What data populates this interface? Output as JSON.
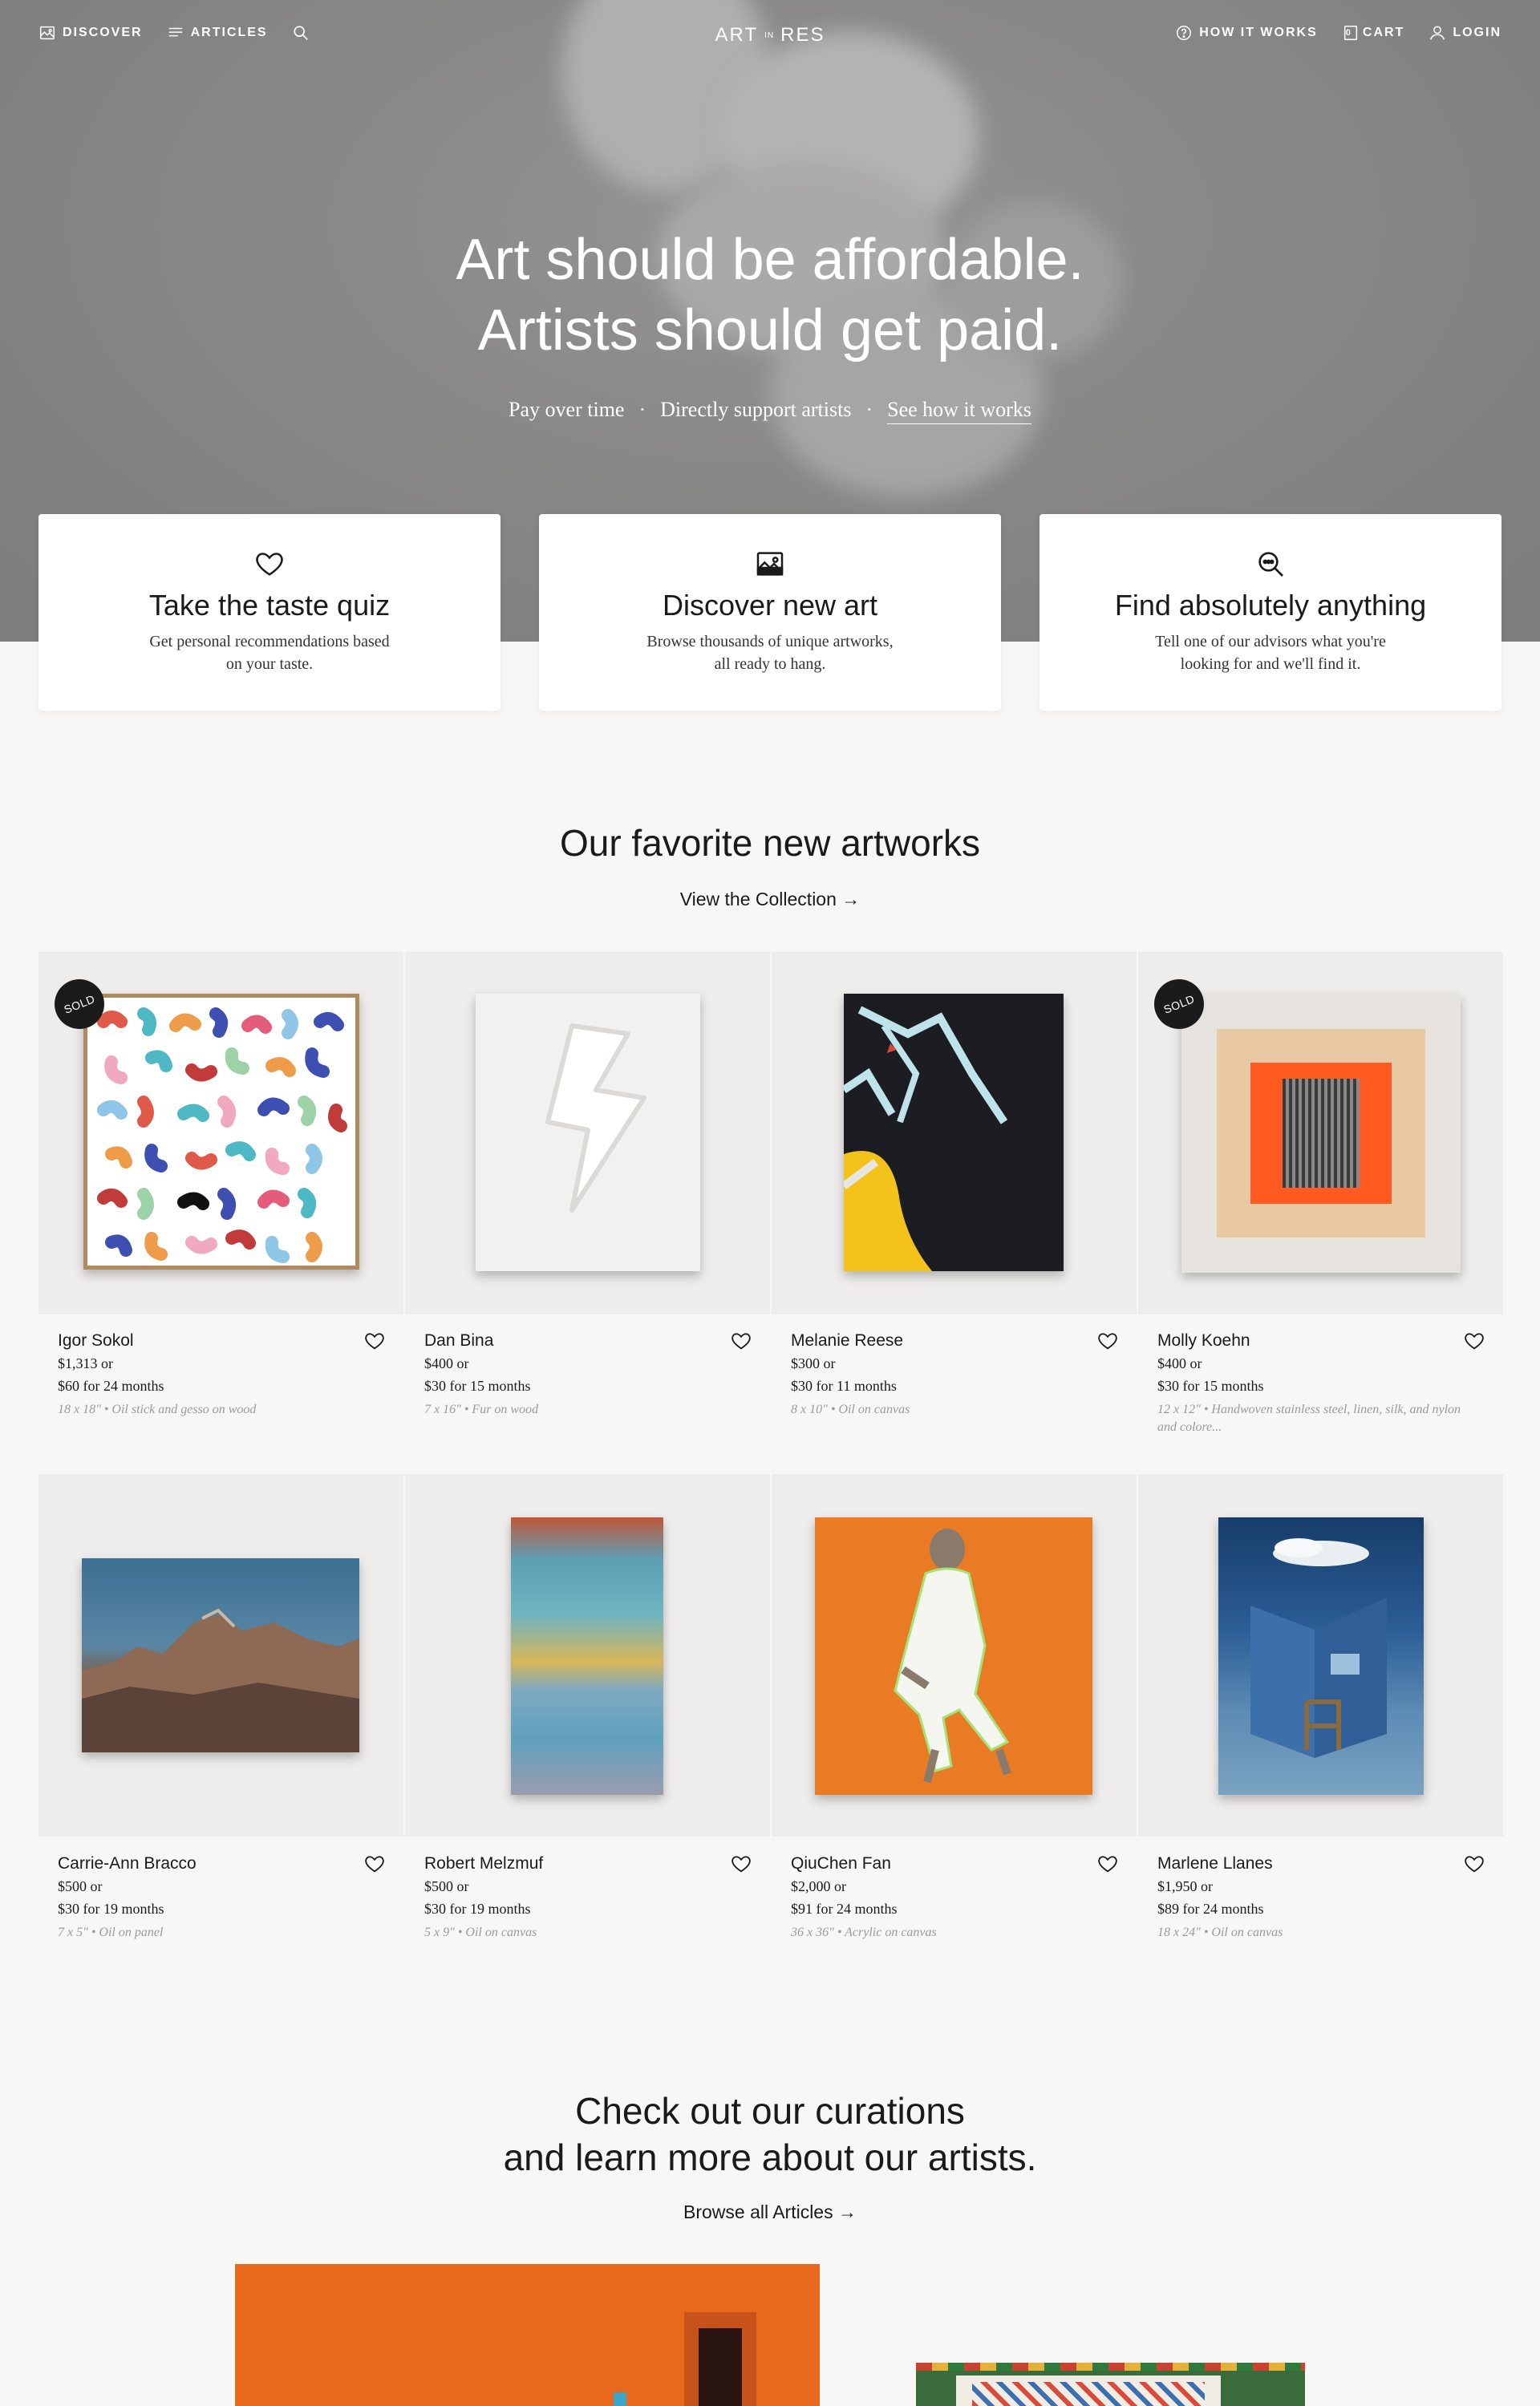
{
  "nav": {
    "discover": "DISCOVER",
    "articles": "ARTICLES",
    "logo_left": "ART",
    "logo_mid": "IN",
    "logo_right": "RES",
    "how_it_works": "HOW IT WORKS",
    "cart_count": "0",
    "cart": "CART",
    "login": "LOGIN"
  },
  "hero": {
    "title_line1": "Art should be affordable.",
    "title_line2": "Artists should get paid.",
    "sub1": "Pay over time",
    "sub2": "Directly support artists",
    "sub3": "See how it works",
    "dot": "·"
  },
  "features": [
    {
      "title": "Take the taste quiz",
      "desc": "Get personal recommendations based on your taste.",
      "icon": "heart-icon"
    },
    {
      "title": "Discover new art",
      "desc": "Browse thousands of unique artworks, all ready to hang.",
      "icon": "image-icon"
    },
    {
      "title": "Find absolutely anything",
      "desc": "Tell one of our advisors what you're looking for and we'll find it.",
      "icon": "search-chat-icon"
    }
  ],
  "favorites": {
    "title": "Our favorite new artworks",
    "link": "View the Collection →"
  },
  "artworks": [
    {
      "artist": "Igor Sokol",
      "price": "$1,313 or",
      "monthly": "$60 for 24 months",
      "details": "18 x 18\" • Oil stick and gesso on wood",
      "sold": "SOLD"
    },
    {
      "artist": "Dan Bina",
      "price": "$400 or",
      "monthly": "$30 for 15 months",
      "details": "7 x 16\" • Fur on wood"
    },
    {
      "artist": "Melanie Reese",
      "price": "$300 or",
      "monthly": "$30 for 11 months",
      "details": "8 x 10\" • Oil on canvas"
    },
    {
      "artist": "Molly Koehn",
      "price": "$400 or",
      "monthly": "$30 for 15 months",
      "details": "12 x 12\" • Handwoven stainless steel, linen, silk, and nylon and colore...",
      "sold": "SOLD"
    },
    {
      "artist": "Carrie-Ann Bracco",
      "price": "$500 or",
      "monthly": "$30 for 19 months",
      "details": "7 x 5\" • Oil on panel"
    },
    {
      "artist": "Robert Melzmuf",
      "price": "$500 or",
      "monthly": "$30 for 19 months",
      "details": "5 x 9\" • Oil on canvas"
    },
    {
      "artist": "QiuChen Fan",
      "price": "$2,000 or",
      "monthly": "$91 for 24 months",
      "details": "36 x 36\" • Acrylic on canvas"
    },
    {
      "artist": "Marlene Llanes",
      "price": "$1,950 or",
      "monthly": "$89 for 24 months",
      "details": "18 x 24\" • Oil on canvas"
    }
  ],
  "curations": {
    "title_line1": "Check out our curations",
    "title_line2": "and learn more about our artists.",
    "link": "Browse all Articles →"
  },
  "colors": {
    "accent_orange": "#ea6a1a",
    "sold_badge": "#1b1b1b"
  }
}
